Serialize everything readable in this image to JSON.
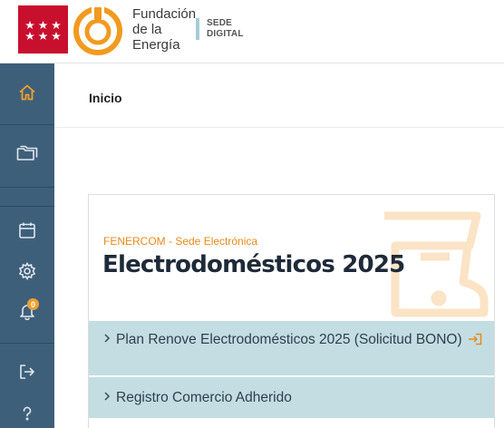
{
  "header": {
    "org_name_line1": "Fundación",
    "org_name_line2": "de la",
    "org_name_line3": "Energía",
    "sede_line1": "SEDE",
    "sede_line2": "DIGITAL"
  },
  "sidebar": {
    "items": [
      {
        "icon": "home-icon",
        "active": true
      },
      {
        "icon": "folder-icon"
      },
      {
        "icon": "calendar-icon"
      },
      {
        "icon": "gear-icon"
      },
      {
        "icon": "bell-icon",
        "badge": "0"
      },
      {
        "icon": "logout-icon"
      },
      {
        "icon": "help-icon"
      }
    ]
  },
  "breadcrumb": {
    "label": "Inicio"
  },
  "card": {
    "subtitle": "FENERCOM - Sede Electrónica",
    "title": "Electrodomésticos 2025",
    "accordion": [
      {
        "label": "Plan Renove Electrodomésticos 2025 (Solicitud BONO)",
        "icon": "login-icon"
      },
      {
        "label": "Registro Comercio Adherido"
      }
    ]
  },
  "colors": {
    "sidebar": "#3e5f7a",
    "accent": "#e88a1a",
    "accordion": "#c3dde3",
    "flag_red": "#c8102e"
  }
}
